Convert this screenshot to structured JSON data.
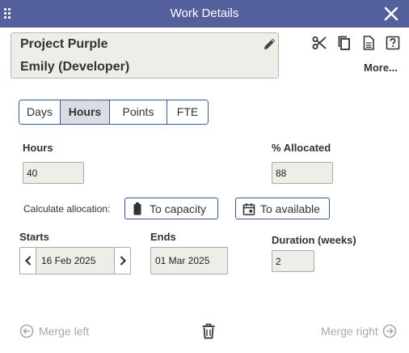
{
  "window": {
    "title": "Work Details"
  },
  "card": {
    "project": "Project Purple",
    "assignee": "Emily (Developer)"
  },
  "toolbar": {
    "more_label": "More..."
  },
  "tabs": [
    {
      "label": "Days",
      "active": false
    },
    {
      "label": "Hours",
      "active": true
    },
    {
      "label": "Points",
      "active": false
    },
    {
      "label": "FTE",
      "active": false
    }
  ],
  "hours": {
    "label": "Hours",
    "value": "40"
  },
  "allocated": {
    "label": "% Allocated",
    "value": "88"
  },
  "calculate": {
    "label": "Calculate allocation:",
    "to_capacity": "To capacity",
    "to_available": "To available"
  },
  "starts": {
    "label": "Starts",
    "value": "16 Feb 2025"
  },
  "ends": {
    "label": "Ends",
    "value": "01 Mar 2025"
  },
  "duration": {
    "label": "Duration (weeks)",
    "value": "2"
  },
  "footer": {
    "merge_left": "Merge left",
    "merge_right": "Merge right"
  },
  "colors": {
    "titlebar": "#54609c",
    "border_accent": "#3a5896",
    "field_bg": "#ecefe8",
    "disabled_text": "#a7aab0"
  }
}
